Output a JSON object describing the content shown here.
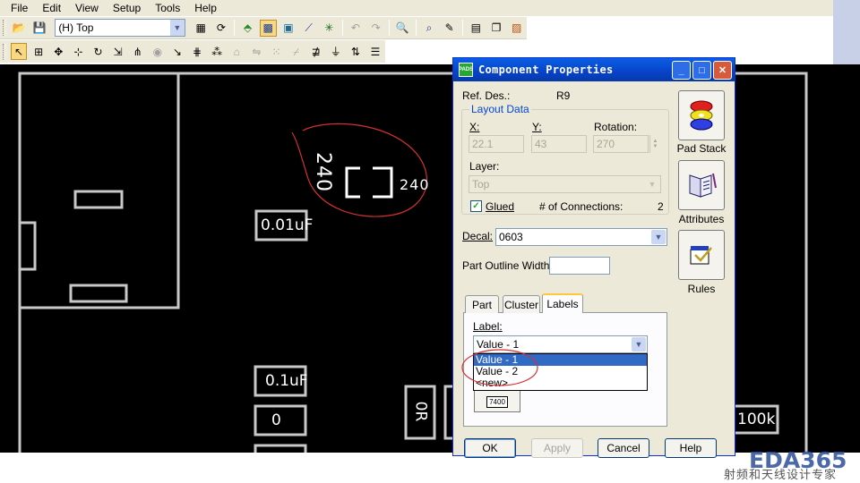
{
  "menu": {
    "items": [
      "File",
      "Edit",
      "View",
      "Setup",
      "Tools",
      "Help"
    ]
  },
  "toolbar": {
    "layer_value": "(H) Top"
  },
  "canvas": {
    "labels": {
      "cap1": "0.01uF",
      "cap2": "0.1uF",
      "comp_zero": "0",
      "comp_0r": "0R",
      "res_100k": "100k",
      "r9_value": "240",
      "r9_rotated": "240"
    },
    "annotation_color": "#d43030",
    "outline_color": "#c8c8c8"
  },
  "dialog": {
    "title": "Component Properties",
    "ref_des_label": "Ref. Des.:",
    "ref_des_value": "R9",
    "layout_group_title": "Layout Data",
    "x_label": "X:",
    "x_value": "22.1",
    "y_label": "Y:",
    "y_value": "43",
    "rotation_label": "Rotation:",
    "rotation_value": "270",
    "layer_label": "Layer:",
    "layer_value": "Top",
    "glued_label": "Glued",
    "glued_checked": true,
    "connections_label": "# of Connections:",
    "connections_value": "2",
    "decal_label": "Decal:",
    "decal_value": "0603",
    "outline_width_label": "Part Outline Width:",
    "outline_width_value": "",
    "side_buttons": {
      "pad_stack": "Pad Stack",
      "attributes": "Attributes",
      "rules": "Rules"
    },
    "tabs": [
      "Part",
      "Cluster",
      "Labels"
    ],
    "active_tab": "Labels",
    "label_field_label": "Label:",
    "label_value": "Value - 1",
    "label_options": [
      "Value - 1",
      "Value - 2",
      "<new>"
    ],
    "label_selected": "Value - 1",
    "label_icon_text": "7400",
    "buttons": {
      "ok": "OK",
      "apply": "Apply",
      "cancel": "Cancel",
      "help": "Help"
    }
  },
  "watermark": {
    "logo_text": "EDA365",
    "tagline": "射频和天线设计专家"
  }
}
